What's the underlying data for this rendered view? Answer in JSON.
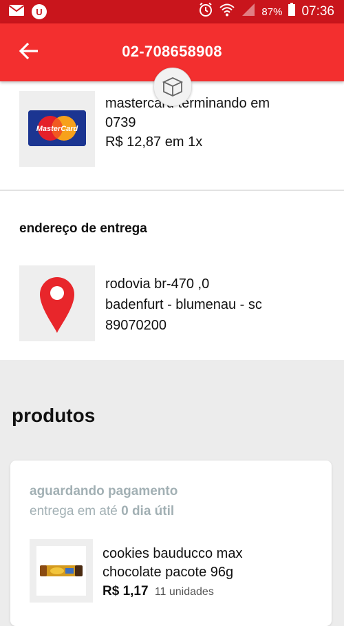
{
  "status_bar": {
    "battery_pct": "87%",
    "time": "07:36",
    "badge_letter": "U",
    "icons": [
      "mail-icon",
      "u-badge-icon",
      "alarm-icon",
      "wifi-icon",
      "signal-icon",
      "battery-icon"
    ]
  },
  "app_bar": {
    "title": "02-708658908",
    "back_icon": "arrow-left-icon",
    "badge_icon": "box-icon"
  },
  "payment": {
    "line1": "mastercard terminando em",
    "line2": "0739",
    "amount": "R$ 12,87 em 1x",
    "logo_text": "MasterCard"
  },
  "delivery": {
    "section_title": "endereço de entrega",
    "icon": "location-pin-icon",
    "line1": "rodovia br-470 ,0",
    "line2": "badenfurt - blumenau - sc",
    "line3": "89070200"
  },
  "products": {
    "section_title": "produtos",
    "items": [
      {
        "status": "aguardando pagamento",
        "delivery_prefix": "entrega em até",
        "delivery_days": "0 dia útil",
        "name_line1": "cookies bauducco max",
        "name_line2": "chocolate pacote 96g",
        "price": "R$ 1,17",
        "units": "11 unidades"
      }
    ]
  },
  "colors": {
    "status_bar": "#c9151c",
    "app_bar": "#f32f2f",
    "muted_status": "#a2b0b4",
    "pin_red": "#e8262b"
  }
}
